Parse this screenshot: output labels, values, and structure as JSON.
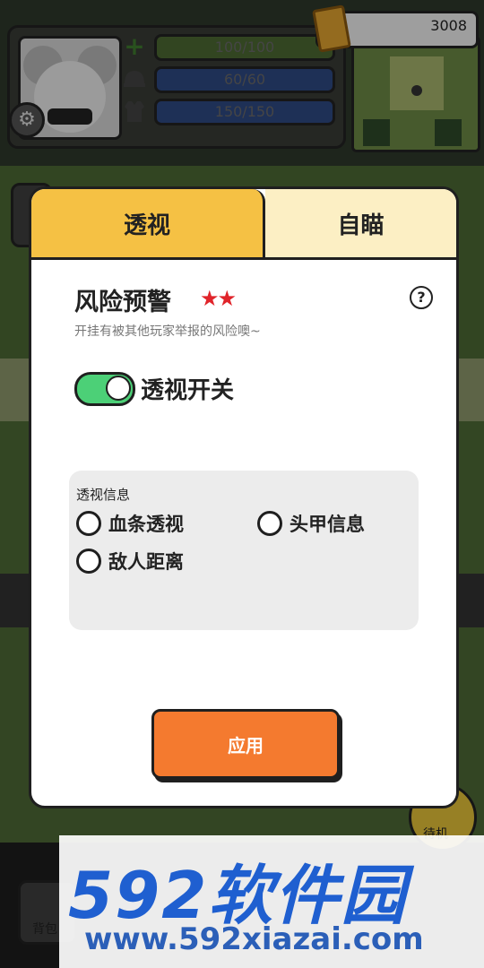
{
  "hud": {
    "coins": "3008",
    "health": "100/100",
    "helmet": "60/60",
    "armor": "150/150",
    "icons": {
      "health": "plus-icon",
      "helmet": "helmet-icon",
      "armor": "vest-icon",
      "settings": "gear-icon",
      "coins": "coin-card-icon"
    }
  },
  "background": {
    "partial_label_1": "背包",
    "partial_label_2": "待机"
  },
  "modal": {
    "tabs": [
      {
        "label": "透视",
        "active": true
      },
      {
        "label": "自瞄",
        "active": false
      }
    ],
    "risk_title": "风险预警",
    "risk_stars": "★★",
    "risk_desc": "开挂有被其他玩家举报的风险噢~",
    "toggle_label": "透视开关",
    "toggle_on": true,
    "info_title": "透视信息",
    "options": [
      {
        "label": "血条透视",
        "checked": false
      },
      {
        "label": "头甲信息",
        "checked": false
      },
      {
        "label": "敌人距离",
        "checked": false
      }
    ],
    "apply_label": "应用"
  },
  "watermark": {
    "brand": "592软件园",
    "url": "www.592xiazai.com"
  },
  "colors": {
    "tab_active": "#f5c144",
    "tab_inactive": "#fcefc4",
    "toggle_on": "#4cd077",
    "apply": "#f47a2f",
    "stars": "#e0242a",
    "watermark": "#1f5fd0"
  }
}
